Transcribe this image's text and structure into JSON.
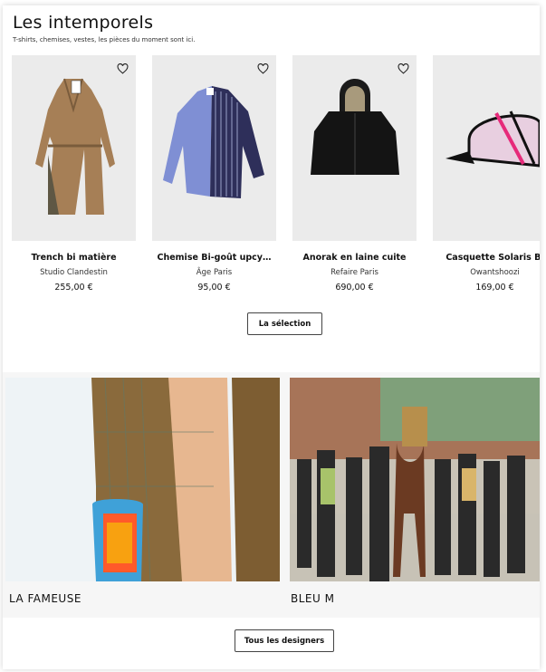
{
  "section": {
    "title": "Les intemporels",
    "subtitle": "T-shirts, chemises, vestes, les pièces du moment sont ici."
  },
  "products": [
    {
      "name": "Trench bi matière",
      "brand": "Studio Clandestin",
      "price": "255,00 €"
    },
    {
      "name": "Chemise Bi-goût upcy…",
      "brand": "Âge Paris",
      "price": "95,00 €"
    },
    {
      "name": "Anorak en laine cuite",
      "brand": "Refaire Paris",
      "price": "690,00 €"
    },
    {
      "name": "Casquette Solaris Bl",
      "brand": "Owantshoozi",
      "price": "169,00 €"
    }
  ],
  "selection_button": "La sélection",
  "designers": [
    {
      "name": "LA FAMEUSE"
    },
    {
      "name": "BLEU M"
    }
  ],
  "designers_button": "Tous les designers",
  "icons": {
    "favorite": "heart-outline-icon"
  }
}
